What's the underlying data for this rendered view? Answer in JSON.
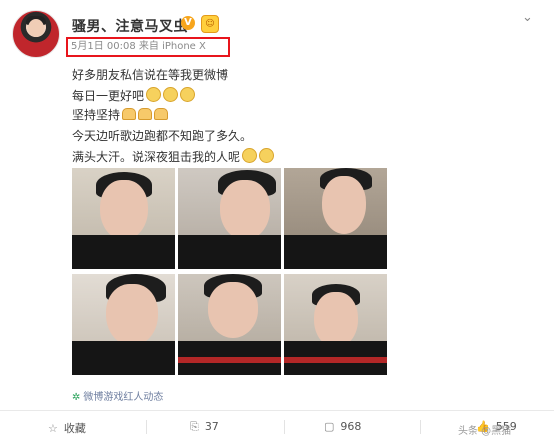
{
  "post": {
    "username": "骚男、注意马叉虫",
    "verified_badge": "V",
    "level_icon": "level-badge-icon",
    "meta": "5月1日 00:08 来自 iPhone X",
    "lines": [
      "好多朋友私信说在等我更微博",
      "每日一更好吧",
      "坚持坚持",
      "今天边听歌边跑都不知跑了多久。",
      "满头大汗。说深夜狙击我的人呢"
    ],
    "photos_count": 6,
    "topic": "微博游戏红人动态",
    "highlight_color": "#e8151c"
  },
  "actions": {
    "collect_label": "收藏",
    "share_count": "37",
    "comment_count": "968",
    "like_count": "559"
  },
  "watermark": "头条 @黑猫"
}
